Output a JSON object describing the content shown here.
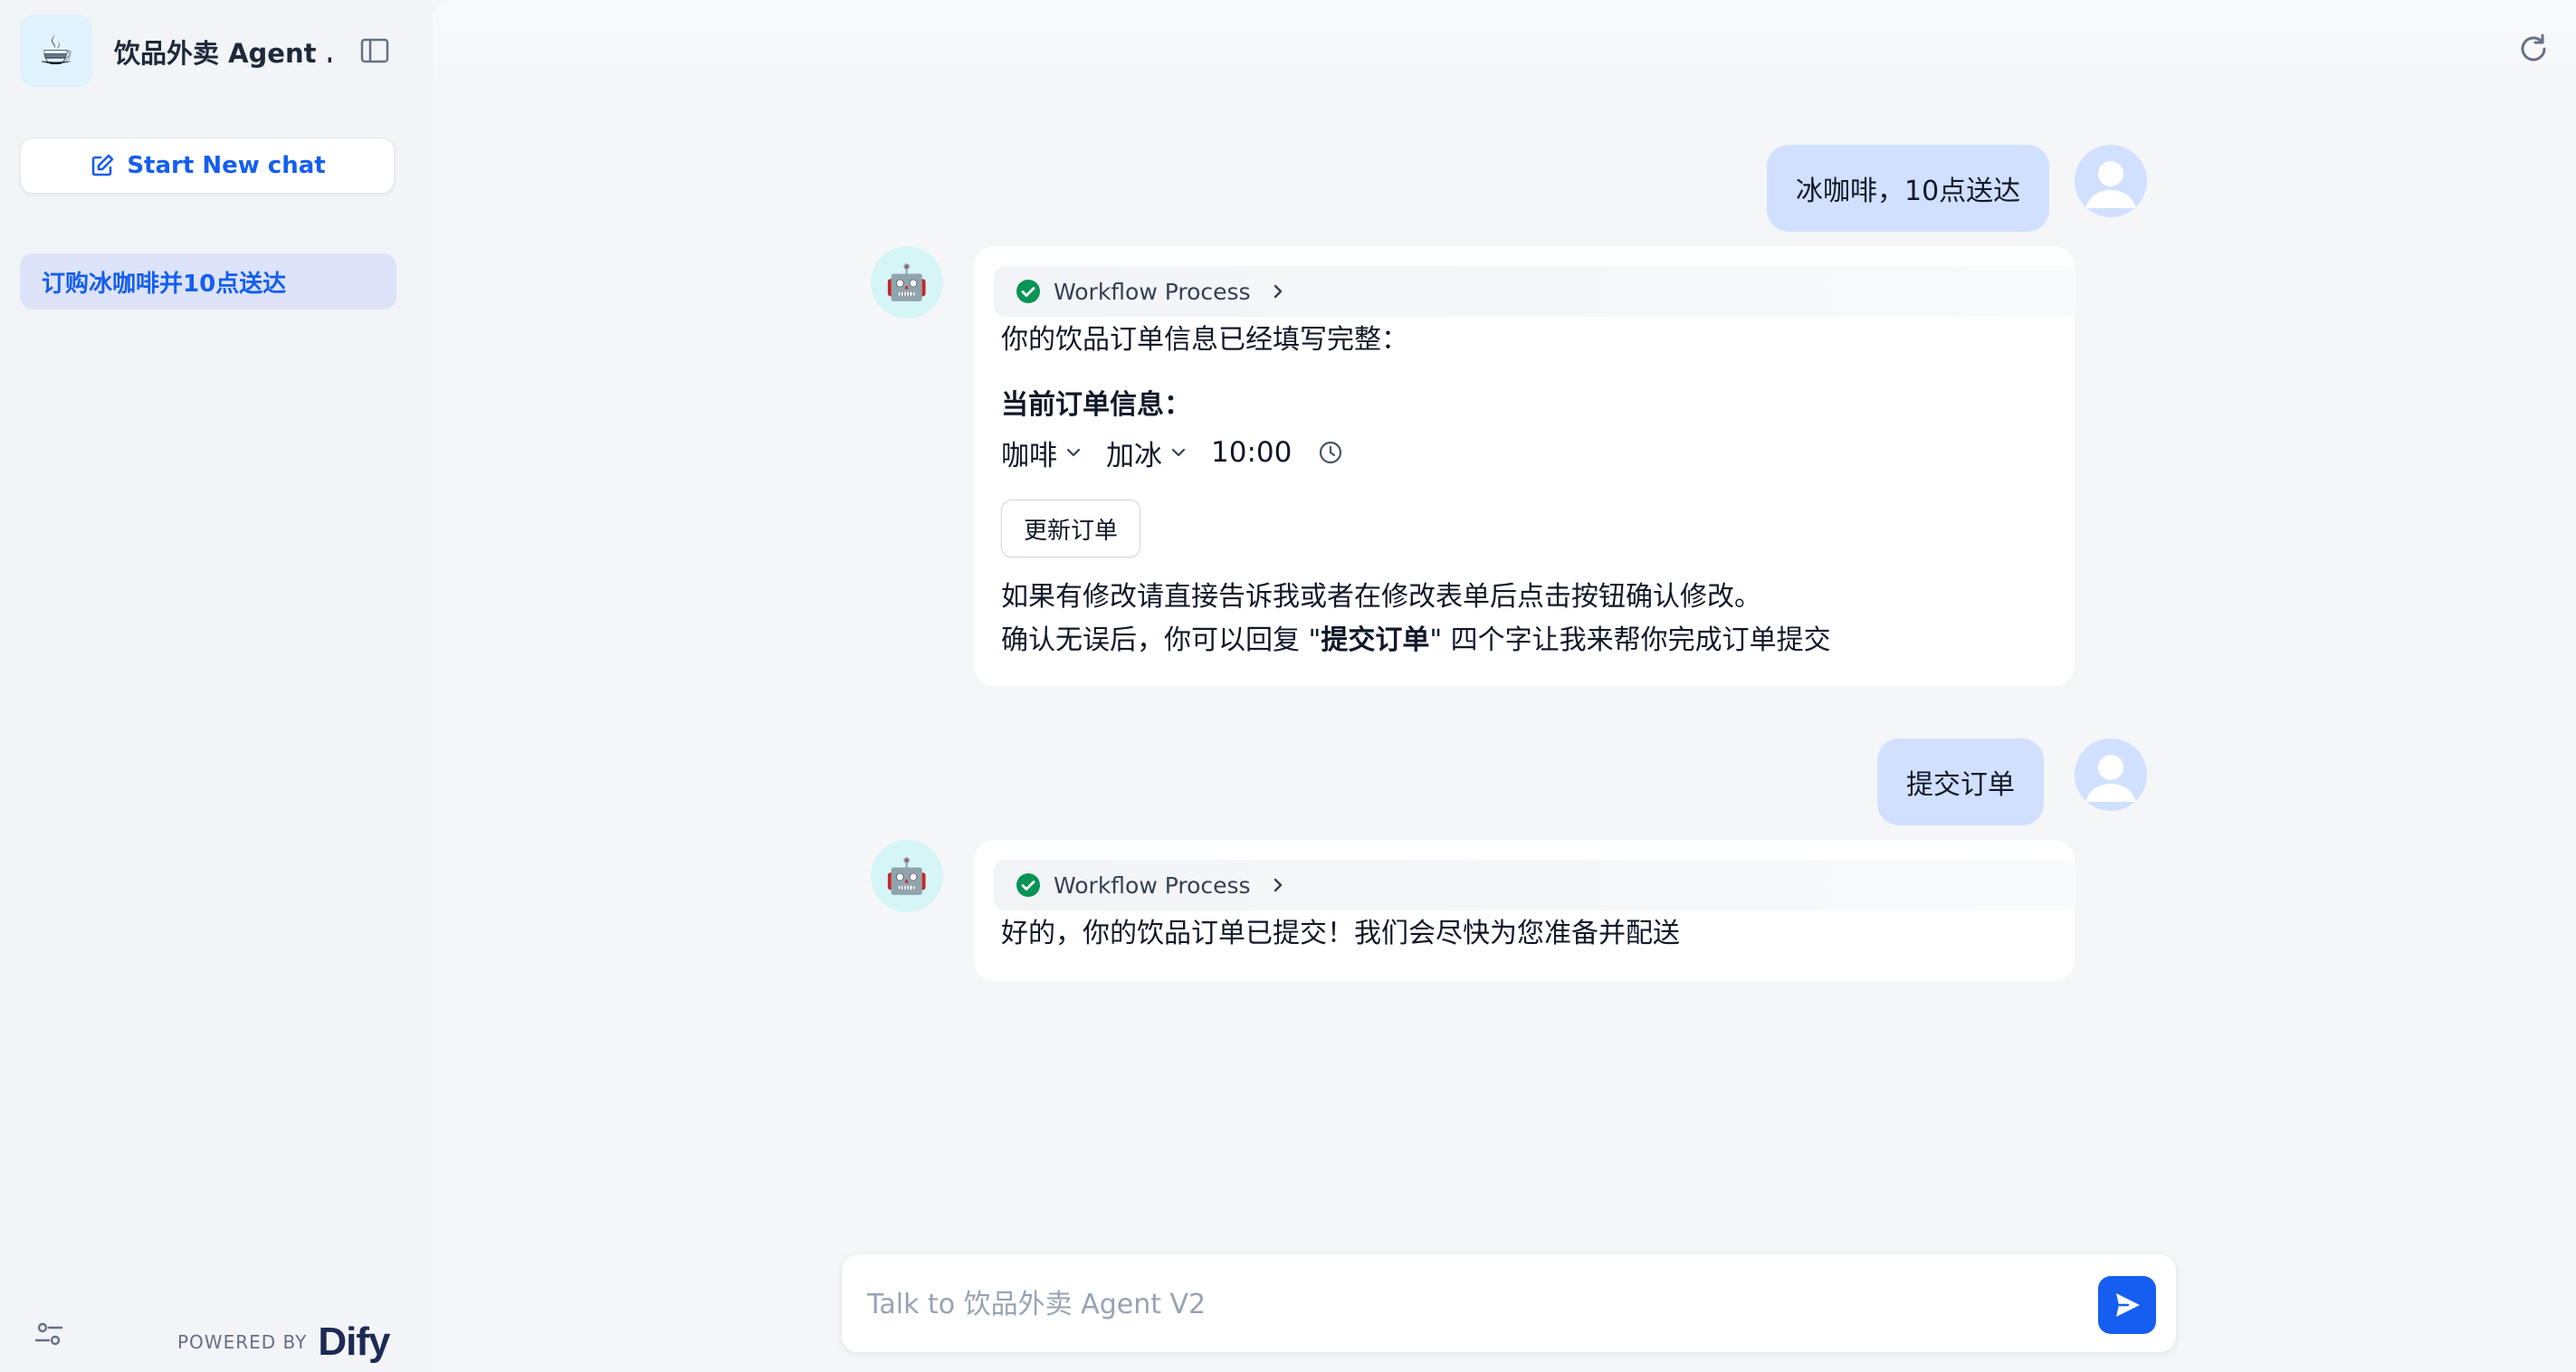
{
  "sidebar": {
    "app_icon": "☕",
    "app_name": "饮品外卖 Agent ...",
    "new_chat_label": "Start New chat",
    "conversations": [
      {
        "label": "订购冰咖啡并10点送达",
        "active": true
      }
    ],
    "powered_by": "POWERED BY",
    "brand": "Dify"
  },
  "chat": {
    "messages": [
      {
        "role": "user",
        "text": "冰咖啡，10点送达"
      },
      {
        "role": "assistant",
        "workflow_label": "Workflow Process",
        "intro": "你的饮品订单信息已经填写完整：",
        "order_heading": "当前订单信息：",
        "order": {
          "drink": "咖啡",
          "temperature": "加冰",
          "time": "10:00"
        },
        "update_button": "更新订单",
        "note_line1": "如果有修改请直接告诉我或者在修改表单后点击按钮确认修改。",
        "note_line2_pre": "确认无误后，你可以回复 \"",
        "note_line2_bold": "提交订单",
        "note_line2_post": "\" 四个字让我来帮你完成订单提交"
      },
      {
        "role": "user",
        "text": "提交订单"
      },
      {
        "role": "assistant",
        "workflow_label": "Workflow Process",
        "text": "好的，你的饮品订单已提交！我们会尽快为您准备并配送"
      }
    ]
  },
  "input": {
    "placeholder": "Talk to 饮品外卖 Agent V2",
    "value": ""
  },
  "colors": {
    "accent": "#155eef",
    "user_bubble": "#d1e0ff",
    "success": "#079455"
  },
  "icons": [
    "coffee-icon",
    "sidebar-toggle-icon",
    "edit-icon",
    "settings-icon",
    "refresh-icon",
    "user-avatar-icon",
    "robot-icon",
    "check-circle-icon",
    "chevron-right-icon",
    "chevron-down-icon",
    "clock-icon",
    "send-icon"
  ]
}
